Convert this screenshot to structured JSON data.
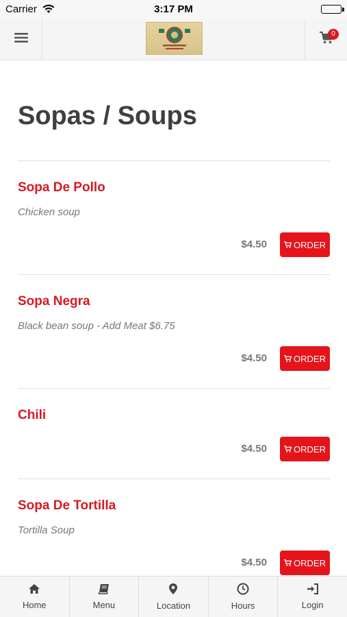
{
  "status_bar": {
    "carrier": "Carrier",
    "time": "3:17 PM",
    "icons": [
      "wifi-icon",
      "battery-icon"
    ]
  },
  "header": {
    "menu_icon": "hamburger-icon",
    "logo_alt": "restaurant-logo",
    "cart_icon": "cart-icon",
    "cart_count": "0"
  },
  "page": {
    "title": "Sopas / Soups"
  },
  "items": [
    {
      "name": "Sopa De Pollo",
      "description": "Chicken soup",
      "price": "$4.50",
      "order_label": "ORDER"
    },
    {
      "name": "Sopa Negra",
      "description": "Black bean soup - Add Meat $6.75",
      "price": "$4.50",
      "order_label": "ORDER"
    },
    {
      "name": "Chili",
      "description": "",
      "price": "$4.50",
      "order_label": "ORDER"
    },
    {
      "name": "Sopa De Tortilla",
      "description": "Tortilla Soup",
      "price": "$4.50",
      "order_label": "ORDER"
    }
  ],
  "tabs": [
    {
      "label": "Home",
      "icon": "home-icon"
    },
    {
      "label": "Menu",
      "icon": "book-icon"
    },
    {
      "label": "Location",
      "icon": "map-pin-icon"
    },
    {
      "label": "Hours",
      "icon": "clock-icon"
    },
    {
      "label": "Login",
      "icon": "login-icon"
    }
  ],
  "colors": {
    "accent": "#e5141b",
    "item_name": "#d71920",
    "title": "#3f3f3f",
    "muted": "#777777"
  }
}
